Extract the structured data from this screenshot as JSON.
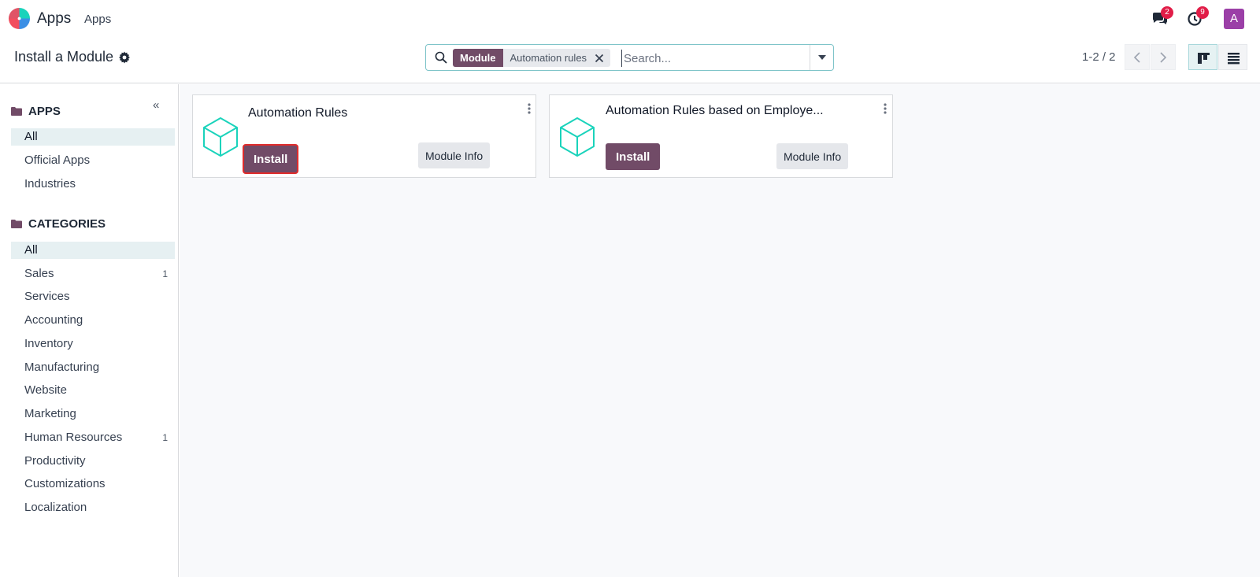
{
  "navbar": {
    "app_name": "Apps",
    "menu_link": "Apps",
    "messages_badge": "2",
    "activities_badge": "9",
    "avatar_letter": "A",
    "avatar_color": "#9b3fa7"
  },
  "control_panel": {
    "title": "Install a Module",
    "search": {
      "facet_label": "Module",
      "facet_value": "Automation rules",
      "placeholder": "Search..."
    },
    "pager": "1-2 / 2"
  },
  "sidebar": {
    "apps_heading": "APPS",
    "apps_items": [
      {
        "label": "All"
      },
      {
        "label": "Official Apps"
      },
      {
        "label": "Industries"
      }
    ],
    "categories_heading": "CATEGORIES",
    "category_items": [
      {
        "label": "All",
        "count": ""
      },
      {
        "label": "Sales",
        "count": "1"
      },
      {
        "label": "Services",
        "count": ""
      },
      {
        "label": "Accounting",
        "count": ""
      },
      {
        "label": "Inventory",
        "count": ""
      },
      {
        "label": "Manufacturing",
        "count": ""
      },
      {
        "label": "Website",
        "count": ""
      },
      {
        "label": "Marketing",
        "count": ""
      },
      {
        "label": "Human Resources",
        "count": "1"
      },
      {
        "label": "Productivity",
        "count": ""
      },
      {
        "label": "Customizations",
        "count": ""
      },
      {
        "label": "Localization",
        "count": ""
      }
    ]
  },
  "modules": [
    {
      "title": "Automation Rules",
      "install_label": "Install",
      "info_label": "Module Info"
    },
    {
      "title": "Automation Rules based on Employe...",
      "install_label": "Install",
      "info_label": "Module Info"
    }
  ],
  "colors": {
    "brand": "#714b67",
    "accent": "#1ad3bb",
    "badge": "#e11d48"
  }
}
